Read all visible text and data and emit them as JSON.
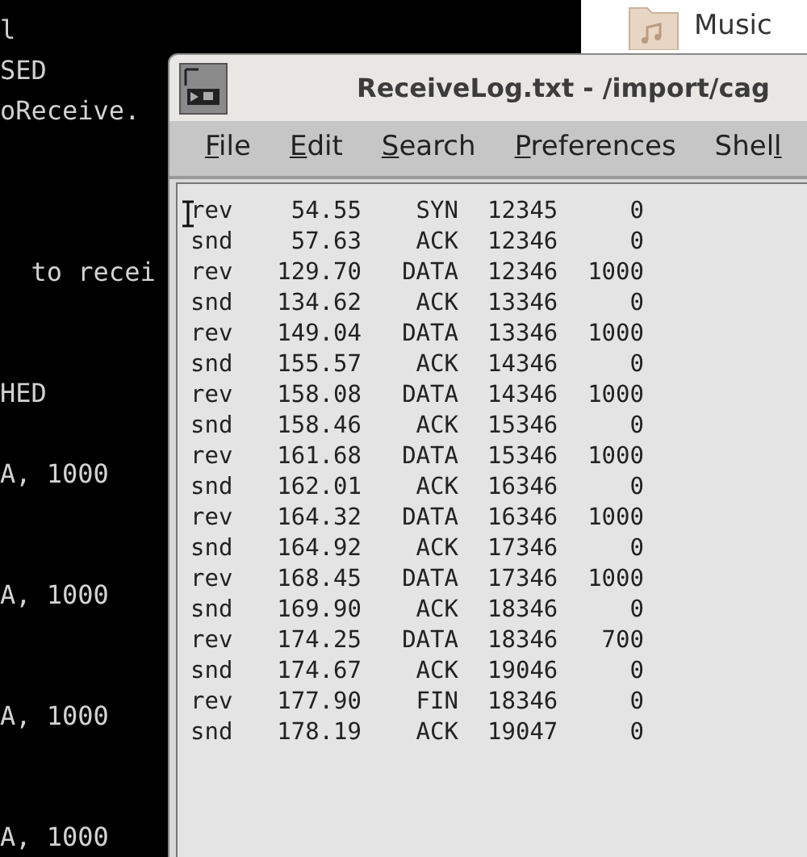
{
  "terminal": {
    "lines": [
      "l",
      "SED",
      "oReceive.",
      "  to recei",
      "HED",
      "A, 1000",
      "A, 1000",
      "A, 1000",
      "A, 1000"
    ]
  },
  "desktop": {
    "icons": [
      {
        "label": "Music"
      }
    ]
  },
  "editor": {
    "title": "ReceiveLog.txt - /import/cag",
    "menu": [
      {
        "key": "F",
        "after": "ile"
      },
      {
        "key": "E",
        "after": "dit"
      },
      {
        "key": "S",
        "after": "earch"
      },
      {
        "key": "P",
        "after": "references"
      },
      {
        "before": "Shel",
        "key": "l"
      }
    ],
    "rows": [
      [
        "rev",
        "54.55",
        "SYN",
        "12345",
        "0"
      ],
      [
        "snd",
        "57.63",
        "ACK",
        "12346",
        "0"
      ],
      [
        "rev",
        "129.70",
        "DATA",
        "12346",
        "1000"
      ],
      [
        "snd",
        "134.62",
        "ACK",
        "13346",
        "0"
      ],
      [
        "rev",
        "149.04",
        "DATA",
        "13346",
        "1000"
      ],
      [
        "snd",
        "155.57",
        "ACK",
        "14346",
        "0"
      ],
      [
        "rev",
        "158.08",
        "DATA",
        "14346",
        "1000"
      ],
      [
        "snd",
        "158.46",
        "ACK",
        "15346",
        "0"
      ],
      [
        "rev",
        "161.68",
        "DATA",
        "15346",
        "1000"
      ],
      [
        "snd",
        "162.01",
        "ACK",
        "16346",
        "0"
      ],
      [
        "rev",
        "164.32",
        "DATA",
        "16346",
        "1000"
      ],
      [
        "snd",
        "164.92",
        "ACK",
        "17346",
        "0"
      ],
      [
        "rev",
        "168.45",
        "DATA",
        "17346",
        "1000"
      ],
      [
        "snd",
        "169.90",
        "ACK",
        "18346",
        "0"
      ],
      [
        "rev",
        "174.25",
        "DATA",
        "18346",
        "700"
      ],
      [
        "snd",
        "174.67",
        "ACK",
        "19046",
        "0"
      ],
      [
        "rev",
        "177.90",
        "FIN",
        "18346",
        "0"
      ],
      [
        "snd",
        "178.19",
        "ACK",
        "19047",
        "0"
      ]
    ]
  }
}
